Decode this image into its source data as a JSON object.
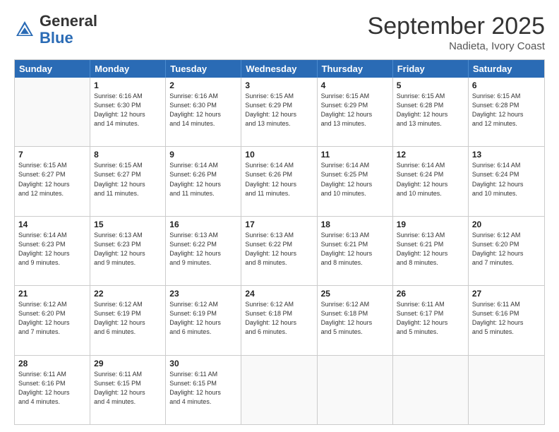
{
  "header": {
    "logo_general": "General",
    "logo_blue": "Blue",
    "month_title": "September 2025",
    "location": "Nadieta, Ivory Coast"
  },
  "day_headers": [
    "Sunday",
    "Monday",
    "Tuesday",
    "Wednesday",
    "Thursday",
    "Friday",
    "Saturday"
  ],
  "weeks": [
    [
      {
        "date": "",
        "info": ""
      },
      {
        "date": "1",
        "info": "Sunrise: 6:16 AM\nSunset: 6:30 PM\nDaylight: 12 hours\nand 14 minutes."
      },
      {
        "date": "2",
        "info": "Sunrise: 6:16 AM\nSunset: 6:30 PM\nDaylight: 12 hours\nand 14 minutes."
      },
      {
        "date": "3",
        "info": "Sunrise: 6:15 AM\nSunset: 6:29 PM\nDaylight: 12 hours\nand 13 minutes."
      },
      {
        "date": "4",
        "info": "Sunrise: 6:15 AM\nSunset: 6:29 PM\nDaylight: 12 hours\nand 13 minutes."
      },
      {
        "date": "5",
        "info": "Sunrise: 6:15 AM\nSunset: 6:28 PM\nDaylight: 12 hours\nand 13 minutes."
      },
      {
        "date": "6",
        "info": "Sunrise: 6:15 AM\nSunset: 6:28 PM\nDaylight: 12 hours\nand 12 minutes."
      }
    ],
    [
      {
        "date": "7",
        "info": "Sunrise: 6:15 AM\nSunset: 6:27 PM\nDaylight: 12 hours\nand 12 minutes."
      },
      {
        "date": "8",
        "info": "Sunrise: 6:15 AM\nSunset: 6:27 PM\nDaylight: 12 hours\nand 11 minutes."
      },
      {
        "date": "9",
        "info": "Sunrise: 6:14 AM\nSunset: 6:26 PM\nDaylight: 12 hours\nand 11 minutes."
      },
      {
        "date": "10",
        "info": "Sunrise: 6:14 AM\nSunset: 6:26 PM\nDaylight: 12 hours\nand 11 minutes."
      },
      {
        "date": "11",
        "info": "Sunrise: 6:14 AM\nSunset: 6:25 PM\nDaylight: 12 hours\nand 10 minutes."
      },
      {
        "date": "12",
        "info": "Sunrise: 6:14 AM\nSunset: 6:24 PM\nDaylight: 12 hours\nand 10 minutes."
      },
      {
        "date": "13",
        "info": "Sunrise: 6:14 AM\nSunset: 6:24 PM\nDaylight: 12 hours\nand 10 minutes."
      }
    ],
    [
      {
        "date": "14",
        "info": "Sunrise: 6:14 AM\nSunset: 6:23 PM\nDaylight: 12 hours\nand 9 minutes."
      },
      {
        "date": "15",
        "info": "Sunrise: 6:13 AM\nSunset: 6:23 PM\nDaylight: 12 hours\nand 9 minutes."
      },
      {
        "date": "16",
        "info": "Sunrise: 6:13 AM\nSunset: 6:22 PM\nDaylight: 12 hours\nand 9 minutes."
      },
      {
        "date": "17",
        "info": "Sunrise: 6:13 AM\nSunset: 6:22 PM\nDaylight: 12 hours\nand 8 minutes."
      },
      {
        "date": "18",
        "info": "Sunrise: 6:13 AM\nSunset: 6:21 PM\nDaylight: 12 hours\nand 8 minutes."
      },
      {
        "date": "19",
        "info": "Sunrise: 6:13 AM\nSunset: 6:21 PM\nDaylight: 12 hours\nand 8 minutes."
      },
      {
        "date": "20",
        "info": "Sunrise: 6:12 AM\nSunset: 6:20 PM\nDaylight: 12 hours\nand 7 minutes."
      }
    ],
    [
      {
        "date": "21",
        "info": "Sunrise: 6:12 AM\nSunset: 6:20 PM\nDaylight: 12 hours\nand 7 minutes."
      },
      {
        "date": "22",
        "info": "Sunrise: 6:12 AM\nSunset: 6:19 PM\nDaylight: 12 hours\nand 6 minutes."
      },
      {
        "date": "23",
        "info": "Sunrise: 6:12 AM\nSunset: 6:19 PM\nDaylight: 12 hours\nand 6 minutes."
      },
      {
        "date": "24",
        "info": "Sunrise: 6:12 AM\nSunset: 6:18 PM\nDaylight: 12 hours\nand 6 minutes."
      },
      {
        "date": "25",
        "info": "Sunrise: 6:12 AM\nSunset: 6:18 PM\nDaylight: 12 hours\nand 5 minutes."
      },
      {
        "date": "26",
        "info": "Sunrise: 6:11 AM\nSunset: 6:17 PM\nDaylight: 12 hours\nand 5 minutes."
      },
      {
        "date": "27",
        "info": "Sunrise: 6:11 AM\nSunset: 6:16 PM\nDaylight: 12 hours\nand 5 minutes."
      }
    ],
    [
      {
        "date": "28",
        "info": "Sunrise: 6:11 AM\nSunset: 6:16 PM\nDaylight: 12 hours\nand 4 minutes."
      },
      {
        "date": "29",
        "info": "Sunrise: 6:11 AM\nSunset: 6:15 PM\nDaylight: 12 hours\nand 4 minutes."
      },
      {
        "date": "30",
        "info": "Sunrise: 6:11 AM\nSunset: 6:15 PM\nDaylight: 12 hours\nand 4 minutes."
      },
      {
        "date": "",
        "info": ""
      },
      {
        "date": "",
        "info": ""
      },
      {
        "date": "",
        "info": ""
      },
      {
        "date": "",
        "info": ""
      }
    ]
  ]
}
